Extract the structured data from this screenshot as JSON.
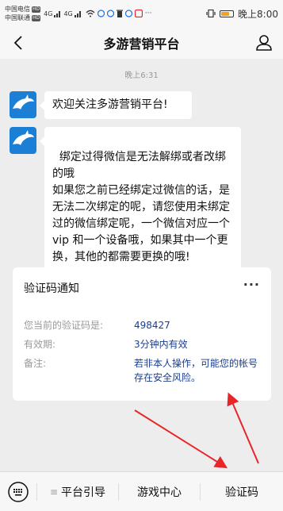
{
  "status_bar": {
    "carrier1": "中国电信",
    "carrier2": "中国联通",
    "hd": "HD",
    "net1": "4G",
    "net2": "4G",
    "time": "晚上8:00",
    "ellipsis": "···"
  },
  "nav": {
    "title": "多游营销平台"
  },
  "chat": {
    "timestamp": "晚上6:31",
    "messages": [
      {
        "text": "欢迎关注多游营销平台!"
      },
      {
        "text": "绑定过得微信是无法解绑或者改绑的哦\n如果您之前已经绑定过微信的话，是无法二次绑定的呢，请您使用未绑定过的微信绑定呢，一个微信对应一个 vip 和一个设备哦，如果其中一个更换，其他的都需要更换的哦!"
      }
    ]
  },
  "card": {
    "title": "验证码通知",
    "more": "···",
    "rows": [
      {
        "label": "您当前的验证码是:",
        "value": "498427"
      },
      {
        "label": "有效期:",
        "value": "3分钟内有效"
      },
      {
        "label": "备注:",
        "value": "若非本人操作，可能您的帐号存在安全风险。"
      }
    ]
  },
  "bottom_menu": {
    "items": [
      {
        "label": "平台引导"
      },
      {
        "label": "游戏中心"
      },
      {
        "label": "验证码"
      }
    ]
  },
  "colors": {
    "value_text": "#1a3d8f",
    "arrow": "#e8262a",
    "battery": "#f4a21d"
  }
}
